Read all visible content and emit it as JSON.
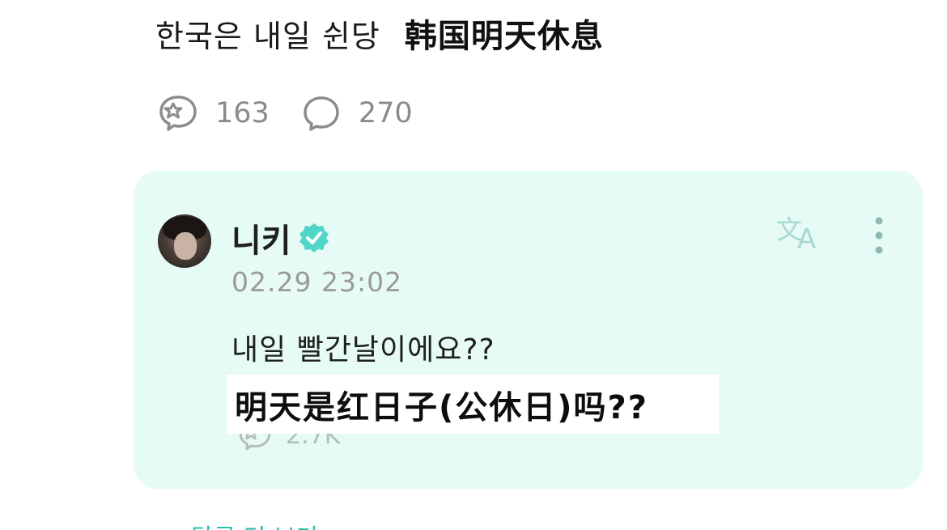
{
  "post": {
    "title_ko": "한국은 내일 쉰당",
    "title_zh": "韩国明天休息",
    "stats": {
      "reactions_icon": "star-bubble-icon",
      "reactions_count": "163",
      "comments_icon": "comment-bubble-icon",
      "comments_count": "270"
    }
  },
  "comment": {
    "avatar_icon": "avatar",
    "username": "니키",
    "verified_icon": "verified-badge-icon",
    "timestamp": "02.29 23:02",
    "text": "내일 빨간날이에요??",
    "translate_icon": "translate-icon",
    "more_icon": "more-vertical-icon",
    "reactions_icon": "star-bubble-icon",
    "reactions_count": "2.7K",
    "card_color": "#e6fbf5",
    "accent_color": "#4fd6c8"
  },
  "caption": {
    "text": "明天是红日子(公休日)吗??"
  },
  "bottom_partial": {
    "text": "답글 더 보기"
  }
}
